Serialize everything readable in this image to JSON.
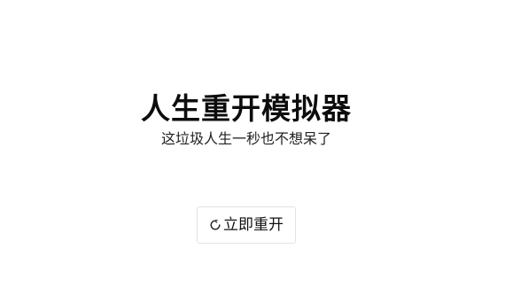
{
  "app": {
    "title": "人生重开模拟器",
    "subtitle": "这垃圾人生一秒也不想呆了"
  },
  "restart_button": {
    "label": "立即重开",
    "icon": "restart-icon"
  }
}
